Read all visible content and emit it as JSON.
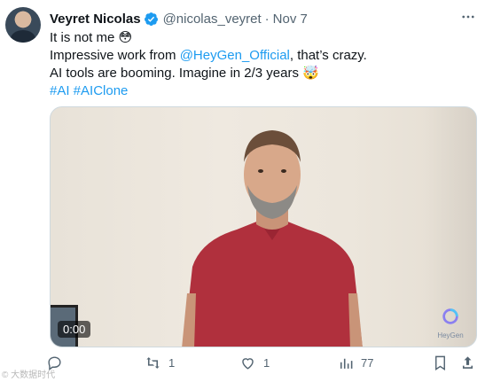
{
  "tweet": {
    "author_name": "Veyret Nicolas",
    "handle": "@nicolas_veyret",
    "separator": "·",
    "date": "Nov 7",
    "lines": [
      {
        "text": "It is not me 😳"
      },
      {
        "pre": "Impressive work from ",
        "link": "@HeyGen_Official",
        "post": ", that’s crazy."
      },
      {
        "text": "AI tools are booming. Imagine in 2/3 years 🤯"
      },
      {
        "tags": "#AI #AIClone"
      }
    ]
  },
  "media": {
    "timestamp": "0:00",
    "brand_label": "HeyGen"
  },
  "actions": {
    "reply_count": "",
    "retweet_count": "1",
    "like_count": "1",
    "views_count": "77"
  },
  "watermark": "© 大数据时代",
  "colors": {
    "link": "#1d9bf0",
    "muted": "#536471",
    "verified": "#1d9bf0",
    "shirt": "#b0303d"
  }
}
